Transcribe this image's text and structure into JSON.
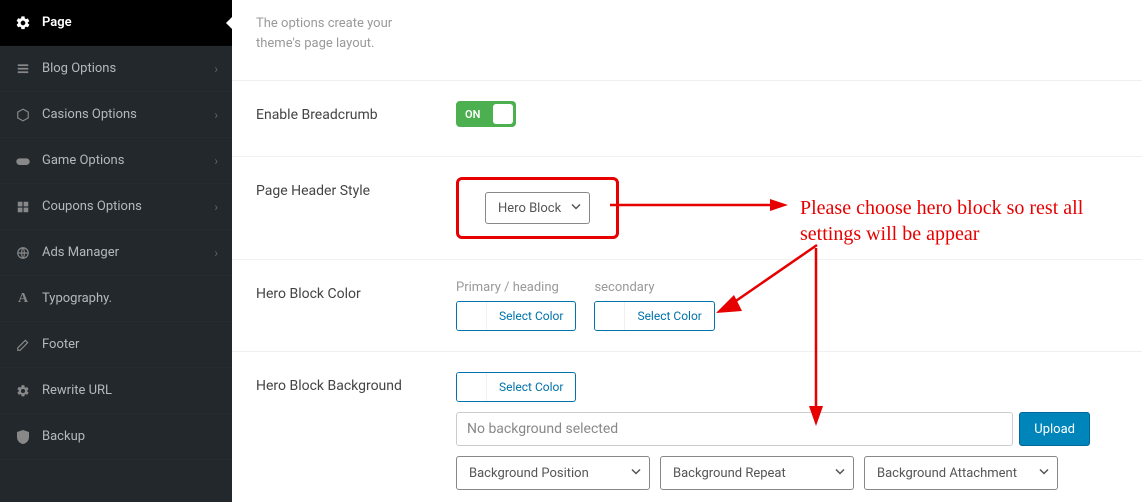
{
  "sidebar": {
    "items": [
      {
        "label": "Page",
        "active": true,
        "chev": false
      },
      {
        "label": "Blog Options",
        "active": false,
        "chev": true
      },
      {
        "label": "Casions Options",
        "active": false,
        "chev": true
      },
      {
        "label": "Game Options",
        "active": false,
        "chev": true
      },
      {
        "label": "Coupons Options",
        "active": false,
        "chev": true
      },
      {
        "label": "Ads Manager",
        "active": false,
        "chev": true
      },
      {
        "label": "Typography.",
        "active": false,
        "chev": false
      },
      {
        "label": "Footer",
        "active": false,
        "chev": false
      },
      {
        "label": "Rewrite URL",
        "active": false,
        "chev": false
      },
      {
        "label": "Backup",
        "active": false,
        "chev": false
      }
    ]
  },
  "main": {
    "description": "The options create your theme's page layout.",
    "enable_breadcrumb": {
      "label": "Enable Breadcrumb",
      "value": "ON"
    },
    "page_header_style": {
      "label": "Page Header Style",
      "value": "Hero Block"
    },
    "hero_block_color": {
      "label": "Hero Block Color",
      "primary_label": "Primary / heading",
      "secondary_label": "secondary",
      "select_color": "Select Color"
    },
    "hero_block_bg": {
      "label": "Hero Block Background",
      "select_color": "Select Color",
      "bg_placeholder": "No background selected",
      "upload": "Upload",
      "bg_position": "Background Position",
      "bg_repeat": "Background Repeat",
      "bg_attachment": "Background Attachment"
    }
  },
  "annotation": {
    "text_line1": "Please choose hero block so rest all",
    "text_line2": "settings will be appear"
  }
}
